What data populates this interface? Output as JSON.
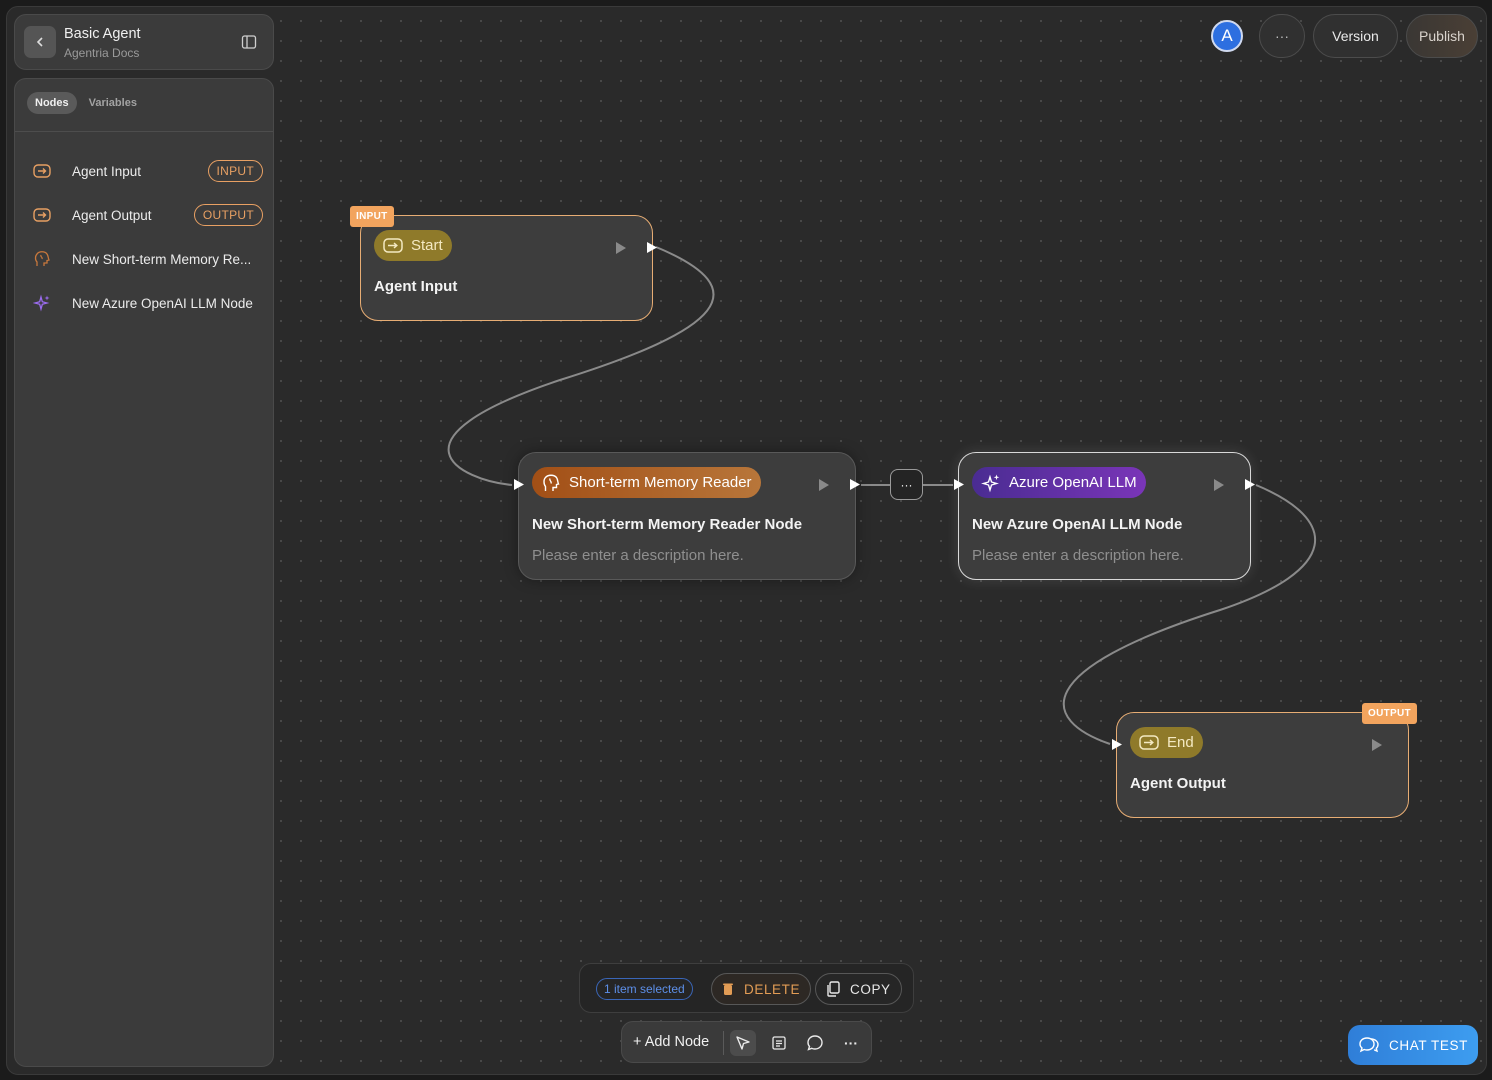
{
  "header": {
    "title": "Basic Agent",
    "subtitle": "Agentria Docs"
  },
  "sidebar": {
    "tabs": [
      {
        "label": "Nodes"
      },
      {
        "label": "Variables"
      }
    ],
    "items": [
      {
        "label": "Agent Input",
        "tag": "INPUT",
        "icon": "arrow-box-icon"
      },
      {
        "label": "Agent Output",
        "tag": "OUTPUT",
        "icon": "arrow-box-icon"
      },
      {
        "label": "New Short-term Memory Re...",
        "icon": "brain-head-icon"
      },
      {
        "label": "New Azure OpenAI LLM Node",
        "icon": "sparkle-icon"
      }
    ]
  },
  "topbar": {
    "avatar_letter": "A",
    "more_label": "···",
    "version_label": "Version",
    "publish_label": "Publish"
  },
  "nodes": {
    "start": {
      "badge": "INPUT",
      "chip": "Start",
      "title": "Agent Input"
    },
    "memory": {
      "chip": "Short-term Memory Reader",
      "title": "New Short-term Memory Reader Node",
      "description": "Please enter a description here."
    },
    "llm": {
      "chip": "Azure OpenAI LLM",
      "title": "New Azure OpenAI LLM Node",
      "description": "Please enter a description here."
    },
    "end": {
      "badge": "OUTPUT",
      "chip": "End",
      "title": "Agent Output"
    }
  },
  "edge_menu_label": "···",
  "selection": {
    "count_label": "1 item selected",
    "delete_label": "DELETE",
    "copy_label": "COPY"
  },
  "toolbar": {
    "add_node_label": "+ Add Node",
    "more_label": "···"
  },
  "chat_test_label": "CHAT TEST",
  "colors": {
    "accent_orange": "#e7ad74",
    "accent_blue": "#2f7ed8",
    "purple": "#7a35b8"
  }
}
